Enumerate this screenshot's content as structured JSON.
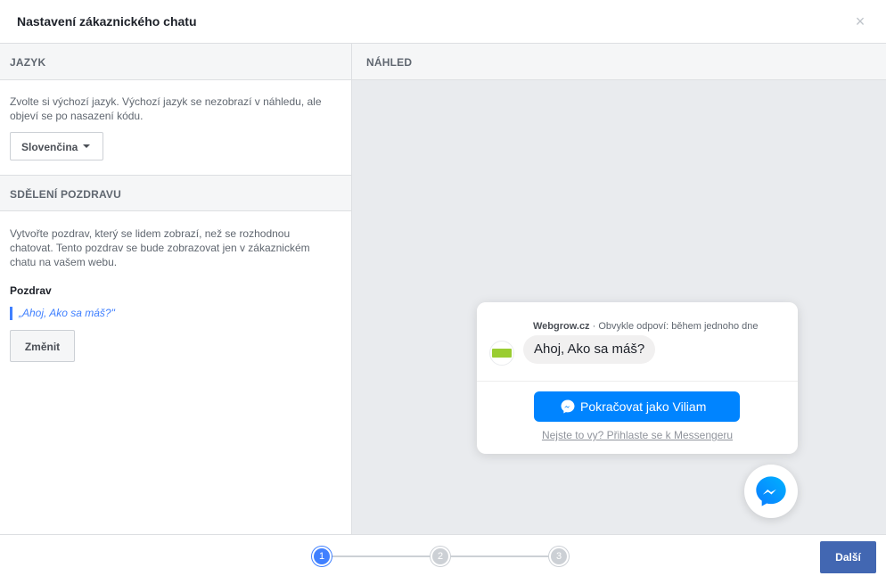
{
  "header": {
    "title": "Nastavení zákaznického chatu",
    "close_glyph": "×"
  },
  "language": {
    "section_title": "JAZYK",
    "description": "Zvolte si výchozí jazyk. Výchozí jazyk se nezobrazí v náhledu, ale objeví se po nasazení kódu.",
    "selected": "Slovenčina"
  },
  "greeting": {
    "section_title": "SDĚLENÍ POZDRAVU",
    "description": "Vytvořte pozdrav, který se lidem zobrazí, než se rozhodnou chatovat. Tento pozdrav se bude zobrazovat jen v zákaznickém chatu na vašem webu.",
    "label": "Pozdrav",
    "quote": "„Ahoj, Ako sa máš?\"",
    "change_label": "Změnit"
  },
  "preview": {
    "section_title": "NÁHLED",
    "site_name": "Webgrow.cz",
    "reply_time": " · Obvykle odpoví: během jednoho dne",
    "bubble_text": "Ahoj, Ako sa máš?",
    "continue_label": "Pokračovat jako Viliam",
    "login_link": "Nejste to vy? Přihlaste se k Messengeru"
  },
  "steps": [
    "1",
    "2",
    "3"
  ],
  "active_step": 1,
  "footer": {
    "next_label": "Další"
  },
  "colors": {
    "accent": "#4080ff",
    "messenger": "#0084ff",
    "primary_button": "#4267b2"
  }
}
